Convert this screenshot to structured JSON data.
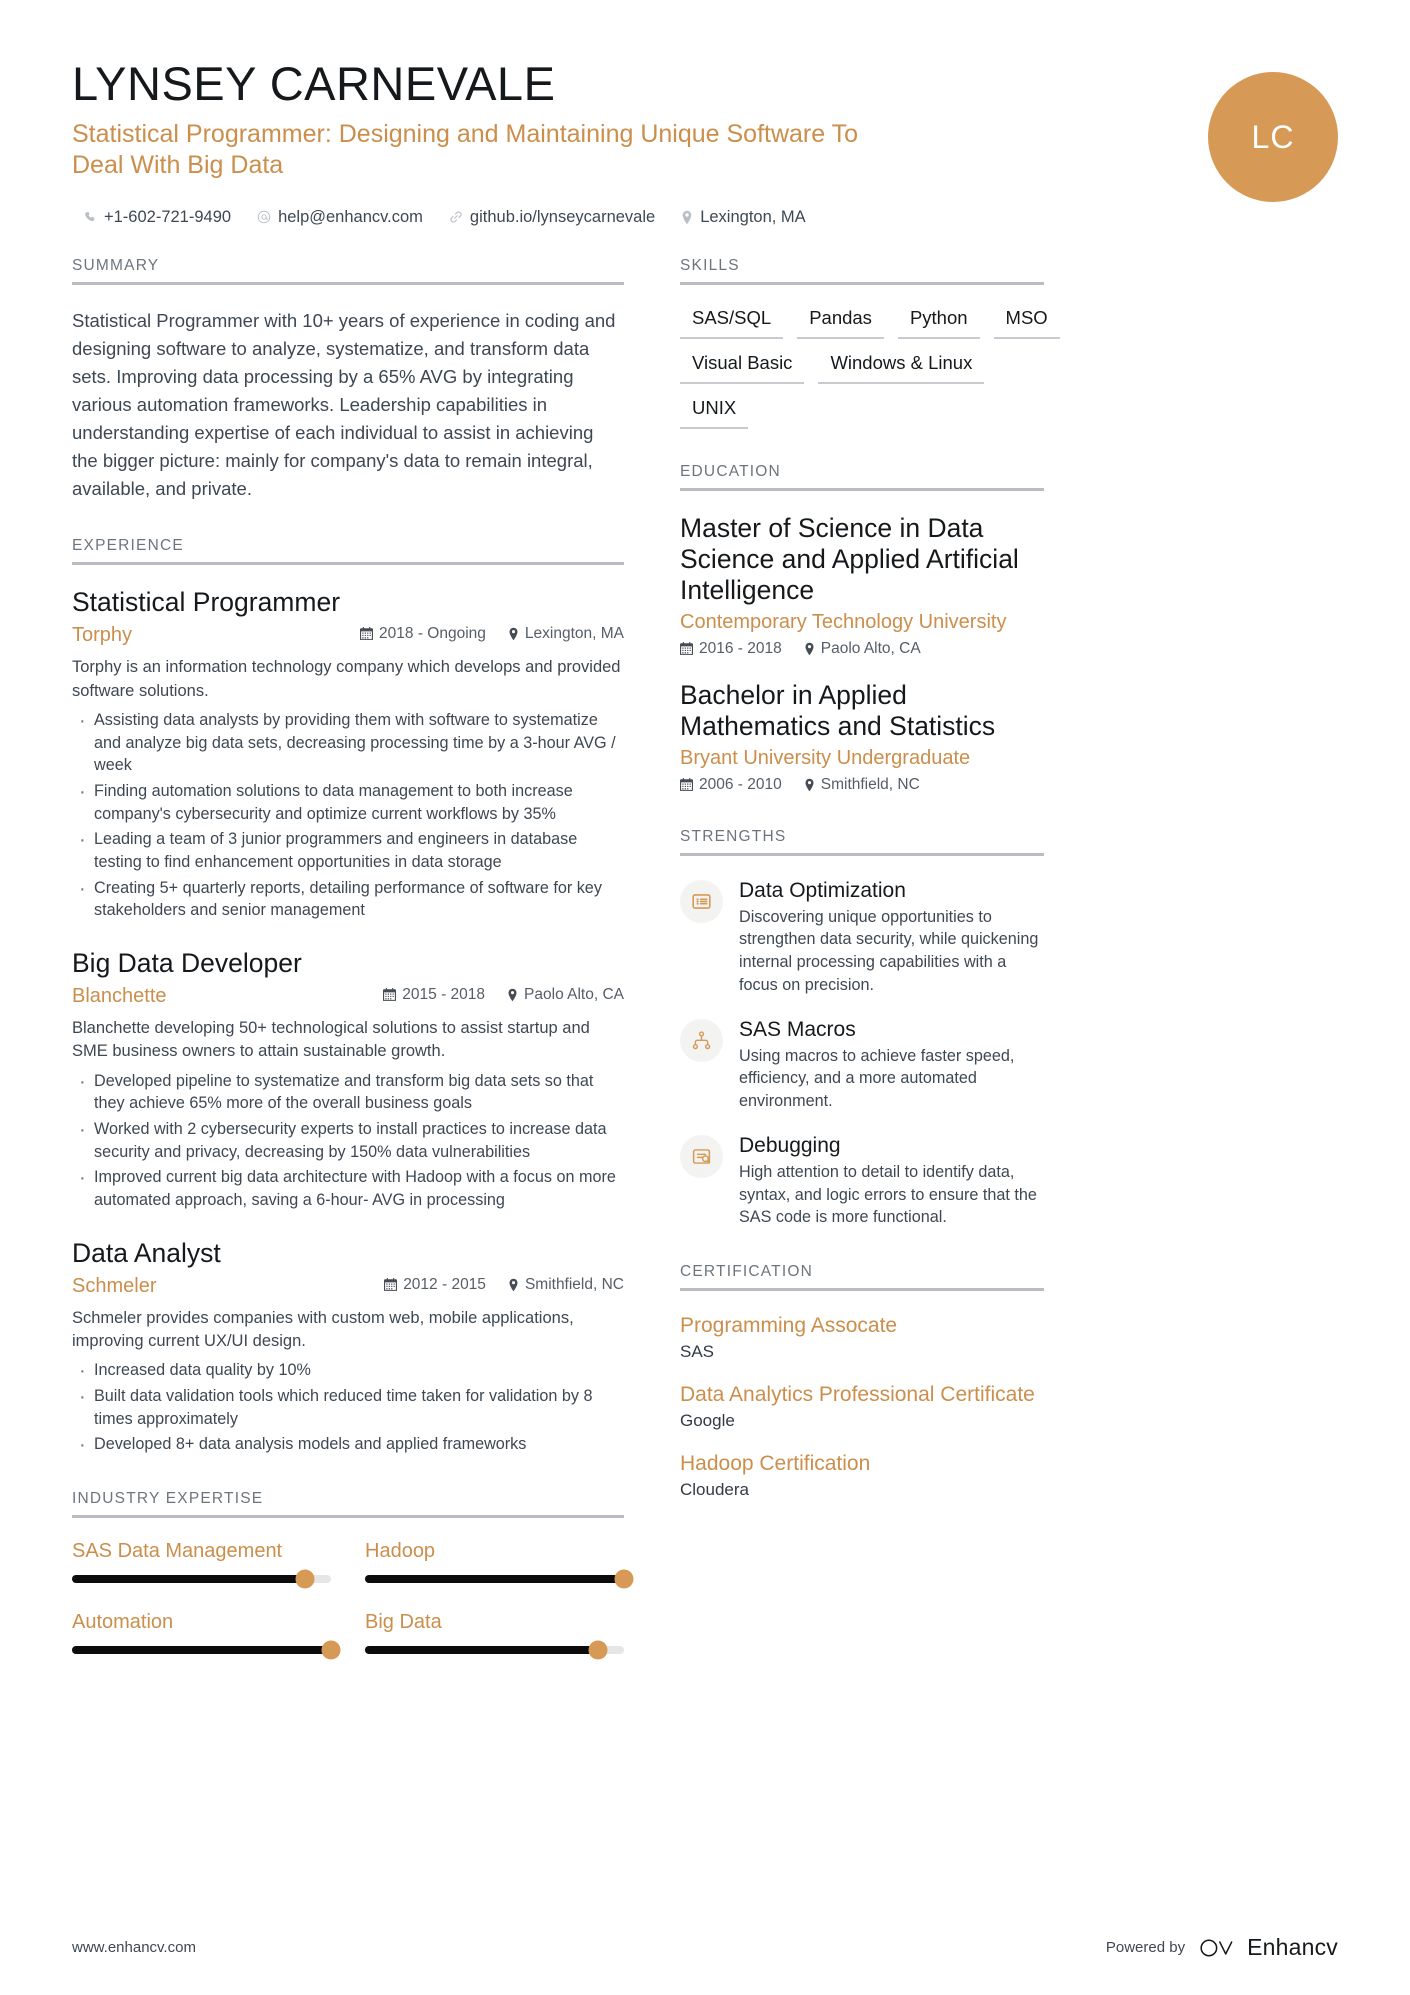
{
  "colors": {
    "accent": "#cb8e4b",
    "avatar_bg": "#d79a56",
    "rule": "#b9bdc2",
    "text": "#3d4853"
  },
  "header": {
    "name": "LYNSEY CARNEVALE",
    "headline": "Statistical Programmer: Designing and Maintaining Unique Software To Deal With Big Data",
    "avatar_initials": "LC",
    "contacts": [
      {
        "icon": "phone-icon",
        "text": "+1-602-721-9490"
      },
      {
        "icon": "email-icon",
        "text": "help@enhancv.com"
      },
      {
        "icon": "link-icon",
        "text": "github.io/lynseycarnevale"
      },
      {
        "icon": "location-pin-icon",
        "text": "Lexington, MA"
      }
    ]
  },
  "summary": {
    "title": "SUMMARY",
    "text": "Statistical Programmer with 10+ years of experience in coding and designing software to analyze, systematize, and transform data sets. Improving data processing by a 65% AVG by integrating various automation frameworks. Leadership capabilities in understanding expertise of each individual to assist in achieving the bigger picture: mainly for company's data to remain integral, available, and private."
  },
  "experience": {
    "title": "EXPERIENCE",
    "jobs": [
      {
        "role": "Statistical Programmer",
        "company": "Torphy",
        "dates": "2018 - Ongoing",
        "location": "Lexington, MA",
        "description": "Torphy is an information technology company which develops and provided software solutions.",
        "bullets": [
          "Assisting data analysts by providing them with software to systematize and analyze big data sets, decreasing processing time by a 3-hour AVG / week",
          "Finding automation solutions to data management to both increase company's cybersecurity and optimize current workflows by 35%",
          "Leading a team of 3 junior programmers and engineers in database testing to find enhancement opportunities in data storage",
          "Creating 5+ quarterly reports, detailing performance of software for key stakeholders and senior management"
        ]
      },
      {
        "role": "Big Data Developer",
        "company": "Blanchette",
        "dates": "2015 - 2018",
        "location": "Paolo Alto, CA",
        "description": "Blanchette developing 50+ technological solutions to assist startup and SME business owners to attain sustainable growth.",
        "bullets": [
          "Developed pipeline to systematize and transform big data sets so that they achieve 65% more of the overall business goals",
          "Worked with 2 cybersecurity experts to install practices to increase data security and privacy, decreasing by 150% data vulnerabilities",
          "Improved current big data architecture with Hadoop with a focus on more automated approach, saving a 6-hour- AVG in processing"
        ]
      },
      {
        "role": "Data Analyst",
        "company": "Schmeler",
        "dates": "2012 - 2015",
        "location": "Smithfield, NC",
        "description": "Schmeler provides companies with custom web, mobile applications, improving current UX/UI design.",
        "bullets": [
          "Increased data quality by 10%",
          "Built data validation tools which reduced time taken for validation by 8 times approximately",
          "Developed 8+ data analysis models and applied frameworks"
        ]
      }
    ]
  },
  "skills": {
    "title": "SKILLS",
    "rows": [
      [
        "SAS/SQL",
        "Pandas",
        "Python",
        "MSO"
      ],
      [
        "Visual Basic",
        "Windows & Linux"
      ],
      [
        "UNIX"
      ]
    ]
  },
  "education": {
    "title": "EDUCATION",
    "items": [
      {
        "degree": "Master of Science in Data Science and Applied Artificial Intelligence",
        "school": "Contemporary Technology University",
        "dates": "2016 - 2018",
        "location": "Paolo Alto, CA"
      },
      {
        "degree": "Bachelor in Applied Mathematics and Statistics",
        "school": "Bryant University Undergraduate",
        "dates": "2006 - 2010",
        "location": "Smithfield, NC"
      }
    ]
  },
  "strengths": {
    "title": "STRENGTHS",
    "items": [
      {
        "icon": "list-card-icon",
        "name": "Data Optimization",
        "description": "Discovering unique opportunities to strengthen data security, while quickening internal processing capabilities with a focus on precision."
      },
      {
        "icon": "hierarchy-icon",
        "name": "SAS Macros",
        "description": "Using macros to achieve faster speed, efficiency, and a more automated environment."
      },
      {
        "icon": "bug-report-icon",
        "name": "Debugging",
        "description": "High attention to detail to identify data, syntax, and logic errors to ensure that the SAS code is more functional."
      }
    ]
  },
  "industry_expertise": {
    "title": "INDUSTRY EXPERTISE",
    "items": [
      {
        "label": "SAS Data Management",
        "percent": 90
      },
      {
        "label": "Hadoop",
        "percent": 100
      },
      {
        "label": "Automation",
        "percent": 100
      },
      {
        "label": "Big Data",
        "percent": 90
      }
    ]
  },
  "certification": {
    "title": "CERTIFICATION",
    "items": [
      {
        "name": "Programming Assocate",
        "issuer": "SAS"
      },
      {
        "name": "Data Analytics Professional Certificate",
        "issuer": "Google"
      },
      {
        "name": "Hadoop Certification",
        "issuer": "Cloudera"
      }
    ]
  },
  "footer": {
    "website": "www.enhancv.com",
    "powered_by": "Powered by",
    "brand": "Enhancv"
  }
}
